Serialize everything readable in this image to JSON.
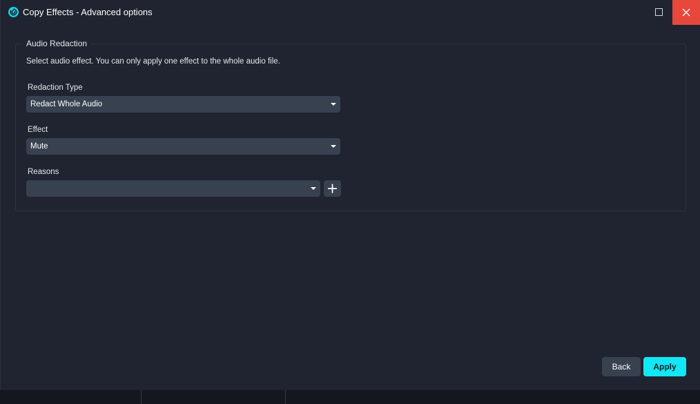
{
  "window": {
    "title": "Copy Effects - Advanced options",
    "icon": "app-logo-icon",
    "accent_color": "#12e8f5",
    "close_color": "#e8483c"
  },
  "group": {
    "legend": "Audio Redaction",
    "description": "Select audio effect. You can only apply one effect to the whole audio file."
  },
  "fields": {
    "redaction_type": {
      "label": "Redaction Type",
      "value": "Redact Whole Audio"
    },
    "effect": {
      "label": "Effect",
      "value": "Mute"
    },
    "reasons": {
      "label": "Reasons",
      "value": ""
    }
  },
  "footer": {
    "back_label": "Back",
    "apply_label": "Apply"
  }
}
